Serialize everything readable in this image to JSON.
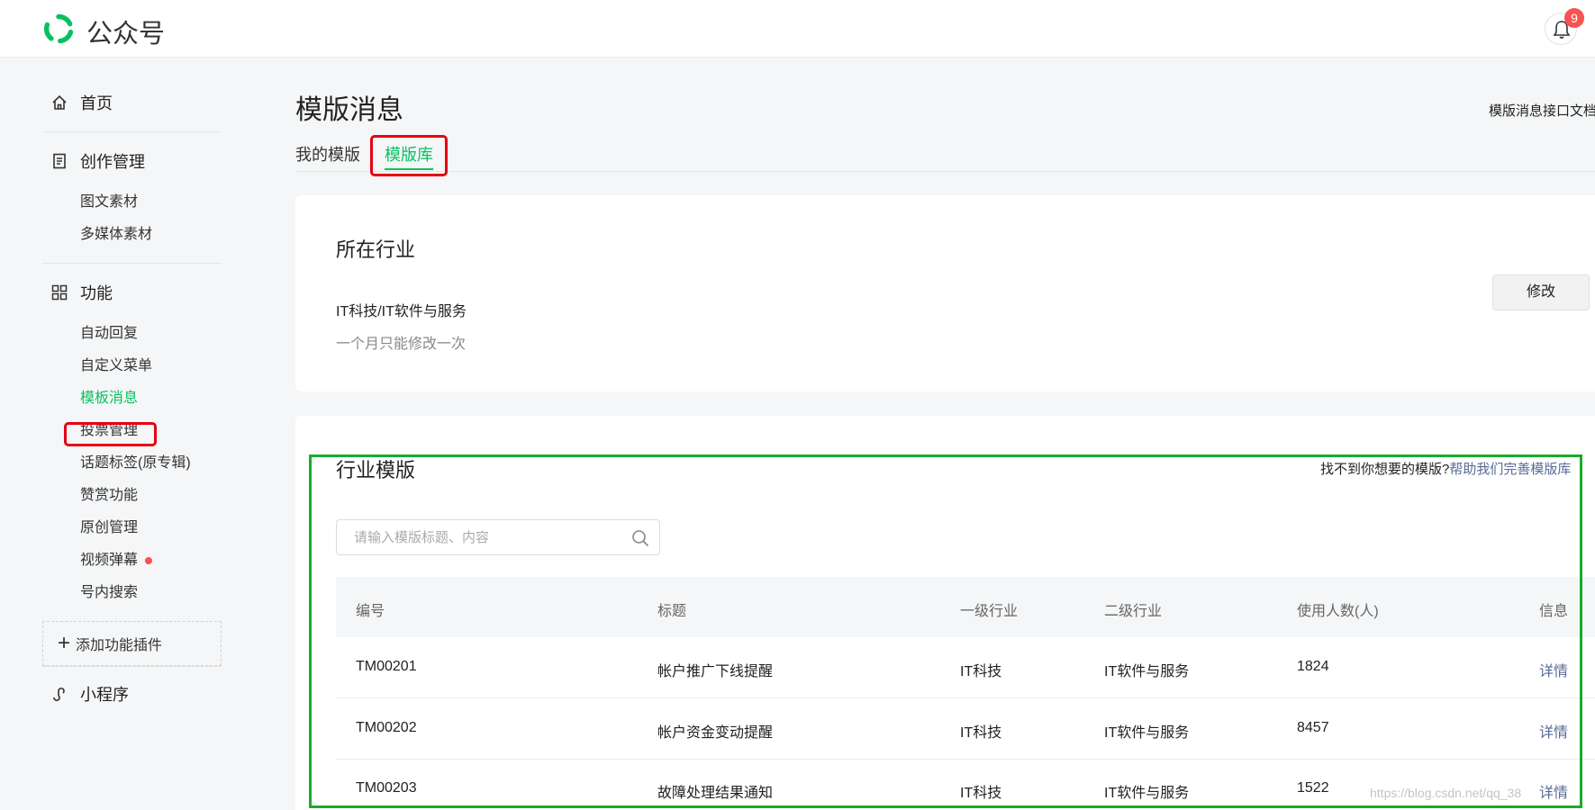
{
  "header": {
    "brand": "公众号",
    "notification_count": "9"
  },
  "sidebar": {
    "home": "首页",
    "creation": {
      "label": "创作管理",
      "items": [
        "图文素材",
        "多媒体素材"
      ]
    },
    "features": {
      "label": "功能",
      "items": [
        "自动回复",
        "自定义菜单",
        "模板消息",
        "投票管理",
        "话题标签(原专辑)",
        "赞赏功能",
        "原创管理",
        "视频弹幕",
        "号内搜索"
      ],
      "active_item": "模板消息"
    },
    "add_plugin": "添加功能插件",
    "mini_program": "小程序"
  },
  "main": {
    "title": "模版消息",
    "doc_link": "模版消息接口文档",
    "tabs": [
      "我的模版",
      "模版库"
    ],
    "active_tab": "模版库",
    "industry": {
      "heading": "所在行业",
      "value": "IT科技/IT软件与服务",
      "note": "一个月只能修改一次",
      "modify_button": "修改"
    },
    "templates": {
      "heading": "行业模版",
      "help_question": "找不到你想要的模版?",
      "help_link": "帮助我们完善模版库",
      "search_placeholder": "请输入模版标题、内容",
      "columns": [
        "编号",
        "标题",
        "一级行业",
        "二级行业",
        "使用人数(人)",
        "信息"
      ],
      "rows": [
        [
          "TM00201",
          "帐户推广下线提醒",
          "IT科技",
          "IT软件与服务",
          "1824",
          "详情"
        ],
        [
          "TM00202",
          "帐户资金变动提醒",
          "IT科技",
          "IT软件与服务",
          "8457",
          "详情"
        ],
        [
          "TM00203",
          "故障处理结果通知",
          "IT科技",
          "IT软件与服务",
          "1522",
          "详情"
        ]
      ]
    }
  },
  "watermark": "https://blog.csdn.net/qq_38",
  "colors": {
    "accent_green": "#07c160",
    "link_blue": "#576b95",
    "annotation_red": "#e60012",
    "annotation_green": "#1aab2a",
    "badge_red": "#fa5151"
  }
}
